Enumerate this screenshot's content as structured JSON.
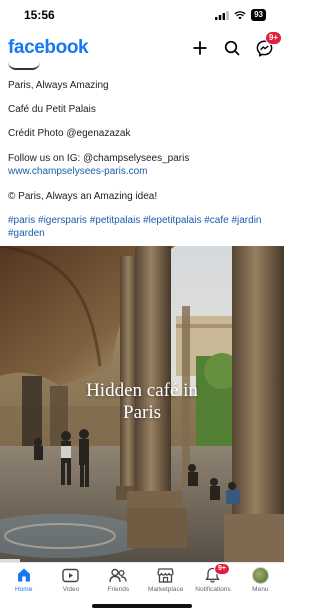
{
  "status_bar": {
    "time": "15:56",
    "battery": "93"
  },
  "header": {
    "logo": "facebook",
    "messenger_badge": "9+"
  },
  "post": {
    "line1": "Paris, Always Amazing",
    "line2": "Café du Petit Palais",
    "line3": "Crédit Photo @egenazazak",
    "line4": "Follow us on IG: @champselysees_paris",
    "website": "www.champselysees-paris.com",
    "line5": "© Paris, Always an Amazing idea!",
    "hashtags": "#paris #igersparis #petitpalais #lepetitpalais #cafe #jardin #garden"
  },
  "media": {
    "overlay_line1": "Hidden café in",
    "overlay_line2": "Paris",
    "progress": 0.07
  },
  "bottom_nav": {
    "items": [
      {
        "label": "Home",
        "icon": "home-icon",
        "active": true
      },
      {
        "label": "Video",
        "icon": "video-icon"
      },
      {
        "label": "Friends",
        "icon": "friends-icon"
      },
      {
        "label": "Marketplace",
        "icon": "marketplace-icon"
      },
      {
        "label": "Notifications",
        "icon": "bell-icon",
        "badge": "9+"
      },
      {
        "label": "Menu",
        "icon": "avatar"
      }
    ]
  },
  "colors": {
    "brand": "#1877f2",
    "link": "#1a5dad",
    "badge": "#e41e3f"
  }
}
